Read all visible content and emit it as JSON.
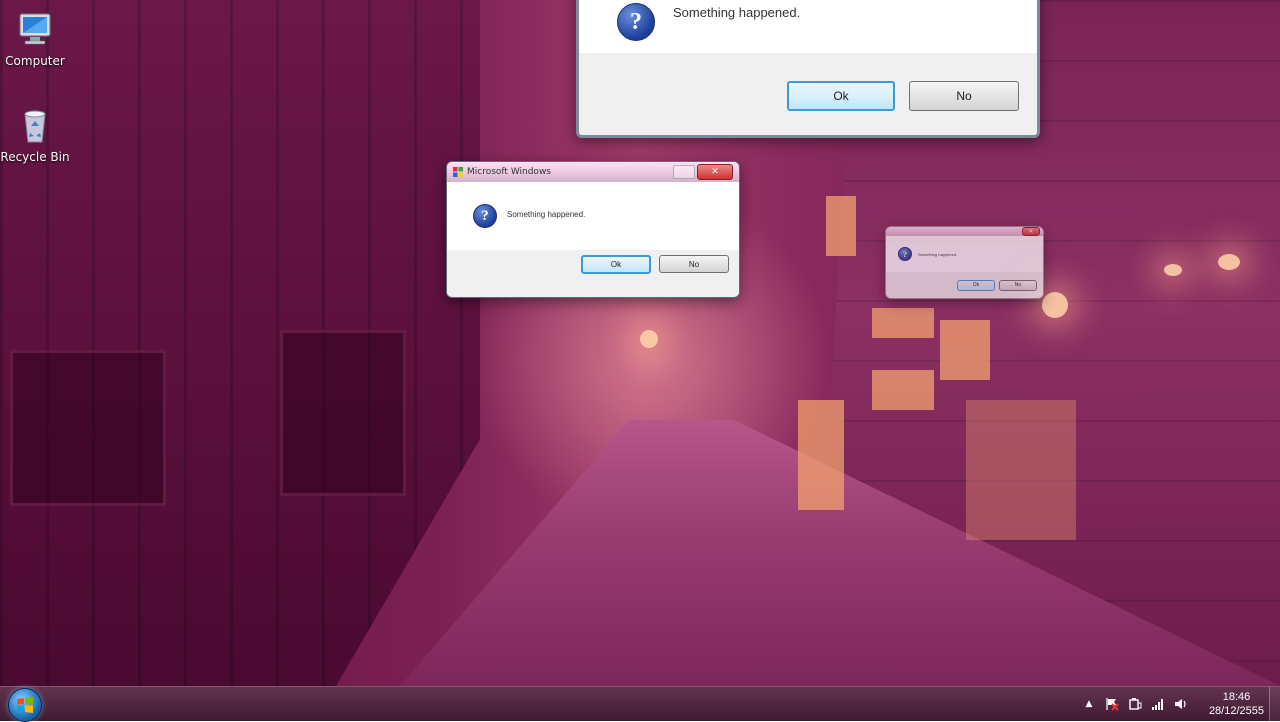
{
  "desktop": {
    "icons": [
      {
        "label": "Computer",
        "icon": "computer-icon"
      },
      {
        "label": "Recycle Bin",
        "icon": "recycle-bin-icon"
      }
    ]
  },
  "dialogs": {
    "top": {
      "message": "Something happened.",
      "ok_label": "Ok",
      "no_label": "No"
    },
    "middle": {
      "title": "Microsoft Windows",
      "message": "Something happened.",
      "ok_label": "Ok",
      "no_label": "No"
    },
    "small": {
      "message": "Something happened.",
      "ok_label": "Ok",
      "no_label": "No"
    }
  },
  "taskbar": {
    "start_icon": "windows-start-orb",
    "tray_icons": [
      "show-hidden-icons-arrow",
      "action-center-flag-icon",
      "power-icon",
      "network-signal-icon",
      "volume-icon"
    ],
    "clock": {
      "time": "18:46",
      "date": "28/12/2555"
    }
  },
  "colors": {
    "wallpaper_tint": "#8a2a5e",
    "default_button_border": "#3a9bd8",
    "question_icon": "#1b3f9a"
  }
}
